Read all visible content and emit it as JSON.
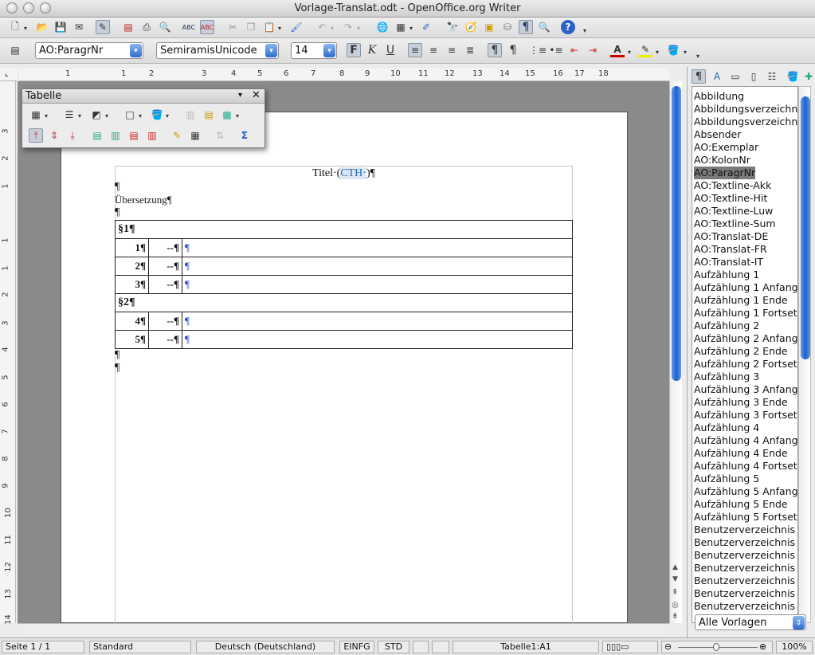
{
  "window": {
    "title": "Vorlage-Translat.odt - OpenOffice.org Writer"
  },
  "formatting": {
    "paragraph_style": "AO:ParagrNr",
    "font_name": "SemiramisUnicode",
    "font_size": "14",
    "bold_label": "F",
    "italic_label": "K",
    "underline_label": "U"
  },
  "ruler": {
    "marks": [
      "1",
      "1",
      "2",
      "3",
      "4",
      "5",
      "6",
      "7",
      "8",
      "9",
      "10",
      "11",
      "12",
      "13",
      "14",
      "15",
      "16",
      "17",
      "18"
    ]
  },
  "vruler": {
    "marks": [
      "3",
      "2",
      "1",
      "1",
      "1",
      "2",
      "3",
      "4",
      "5",
      "6",
      "7",
      "8",
      "9",
      "10",
      "11",
      "12",
      "13",
      "14"
    ]
  },
  "tabelle_toolbar": {
    "title": "Tabelle"
  },
  "document": {
    "title_prefix": "Titel·(",
    "title_highlight": "CTH·",
    "title_suffix": ")¶",
    "pilcrow": "¶",
    "subtitle": "Übersetzung¶",
    "sections": [
      {
        "heading": "§1¶",
        "rows": [
          {
            "num": "1¶",
            "dash": "--¶",
            "text": "¶"
          },
          {
            "num": "2¶",
            "dash": "--¶",
            "text": "¶"
          },
          {
            "num": "3¶",
            "dash": "--¶",
            "text": "¶"
          }
        ]
      },
      {
        "heading": "§2¶",
        "rows": [
          {
            "num": "4¶",
            "dash": "--¶",
            "text": "¶"
          },
          {
            "num": "5¶",
            "dash": "--¶",
            "text": "¶"
          }
        ]
      }
    ]
  },
  "stylist": {
    "selected": "AO:ParagrNr",
    "items": [
      "Abbildung",
      "Abbildungsverzeichnis",
      "Abbildungsverzeichnis",
      "Absender",
      "AO:Exemplar",
      "AO:KolonNr",
      "AO:ParagrNr",
      "AO:Textline-Akk",
      "AO:Textline-Hit",
      "AO:Textline-Luw",
      "AO:Textline-Sum",
      "AO:Translat-DE",
      "AO:Translat-FR",
      "AO:Translat-IT",
      "Aufzählung 1",
      "Aufzählung 1 Anfang",
      "Aufzählung 1 Ende",
      "Aufzählung 1 Fortsetzung",
      "Aufzählung 2",
      "Aufzählung 2 Anfang",
      "Aufzählung 2 Ende",
      "Aufzählung 2 Fortsetzung",
      "Aufzählung 3",
      "Aufzählung 3 Anfang",
      "Aufzählung 3 Ende",
      "Aufzählung 3 Fortsetzung",
      "Aufzählung 4",
      "Aufzählung 4 Anfang",
      "Aufzählung 4 Ende",
      "Aufzählung 4 Fortsetzung",
      "Aufzählung 5",
      "Aufzählung 5 Anfang",
      "Aufzählung 5 Ende",
      "Aufzählung 5 Fortsetzung",
      "Benutzerverzeichnis",
      "Benutzerverzeichnis",
      "Benutzerverzeichnis",
      "Benutzerverzeichnis",
      "Benutzerverzeichnis",
      "Benutzerverzeichnis",
      "Benutzerverzeichnis"
    ],
    "filter": "Alle Vorlagen"
  },
  "statusbar": {
    "page": "Seite 1 / 1",
    "page_style": "Standard",
    "language": "Deutsch (Deutschland)",
    "insert_mode": "EINFG",
    "selection_mode": "STD",
    "cell": "Tabelle1:A1",
    "zoom": "100%"
  }
}
